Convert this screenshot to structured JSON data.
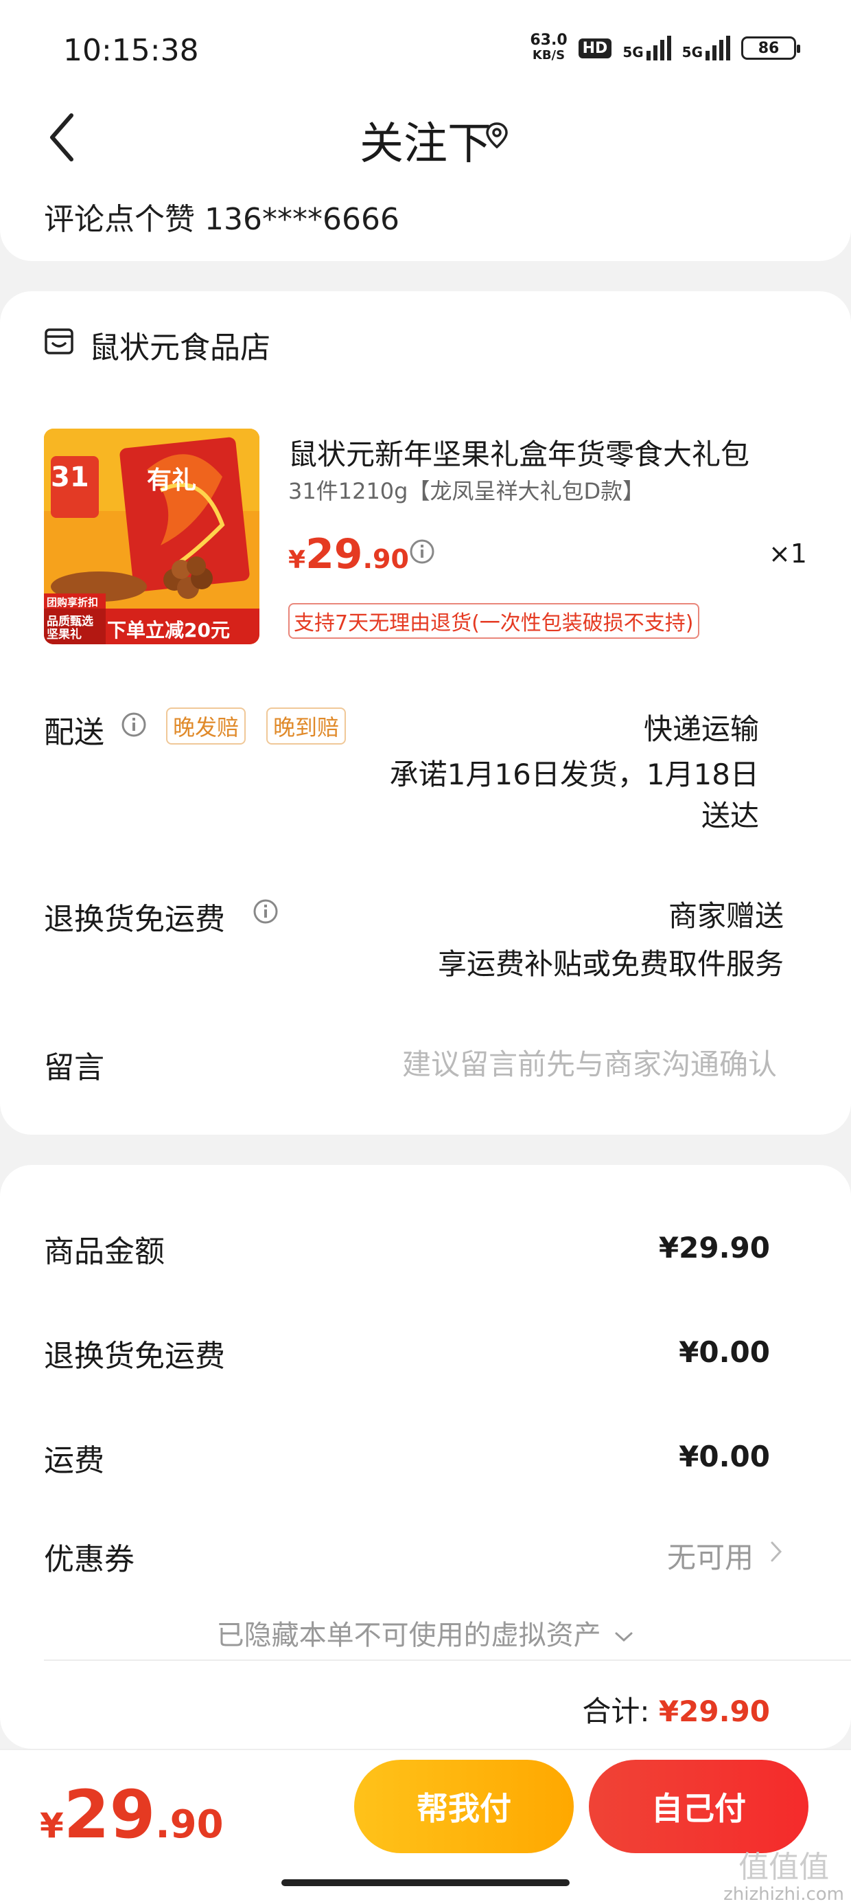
{
  "status": {
    "time": "10:15:38",
    "net_speed": "63.0",
    "net_unit": "KB/S",
    "hd_label": "HD",
    "signal1": "5G",
    "signal2": "5G",
    "battery": "86"
  },
  "header": {
    "title": "关注下",
    "address": "评论点个赞 136****6666"
  },
  "shop": {
    "name": "鼠状元食品店"
  },
  "product": {
    "title": "鼠状元新年坚果礼盒年货零食大礼包",
    "spec": "31件1210g【龙凤呈祥大礼包D款】",
    "price_symbol": "¥",
    "price_int": "29",
    "price_dec": ".90",
    "quantity": "×1",
    "return_policy": "支持7天无理由退货(一次性包装破损不支持)",
    "image_texts": {
      "count": "31",
      "side": "有礼",
      "tag1": "团购享折扣",
      "tag2": "品质甄选坚果礼",
      "promo": "下单立减20元"
    }
  },
  "delivery": {
    "label": "配送",
    "badge1": "晚发赔",
    "badge2": "晚到赔",
    "method": "快递运输",
    "promise_line1": "承诺1月16日发货，1月18日",
    "promise_line2": "送达"
  },
  "return_shipping": {
    "label": "退换货免运费",
    "value_line1": "商家赠送",
    "value_line2": "享运费补贴或免费取件服务"
  },
  "message": {
    "label": "留言",
    "placeholder": "建议留言前先与商家沟通确认"
  },
  "summary": {
    "items": [
      {
        "label": "商品金额",
        "value": "¥29.90"
      },
      {
        "label": "退换货免运费",
        "value": "¥0.00"
      },
      {
        "label": "运费",
        "value": "¥0.00"
      }
    ],
    "coupon_label": "优惠券",
    "coupon_value": "无可用",
    "hidden_assets": "已隐藏本单不可使用的虚拟资产",
    "total_label": "合计:",
    "total_value": "¥29.90"
  },
  "bottom": {
    "price_symbol": "¥",
    "price_int": "29",
    "price_dec": ".90",
    "help_pay": "帮我付",
    "self_pay": "自己付"
  },
  "watermark": {
    "line1": "值值值",
    "line2": "zhizhizhi.com"
  },
  "colors": {
    "accent_red": "#e53a22",
    "accent_orange": "#ffb400",
    "badge_orange": "#e08a2a"
  }
}
